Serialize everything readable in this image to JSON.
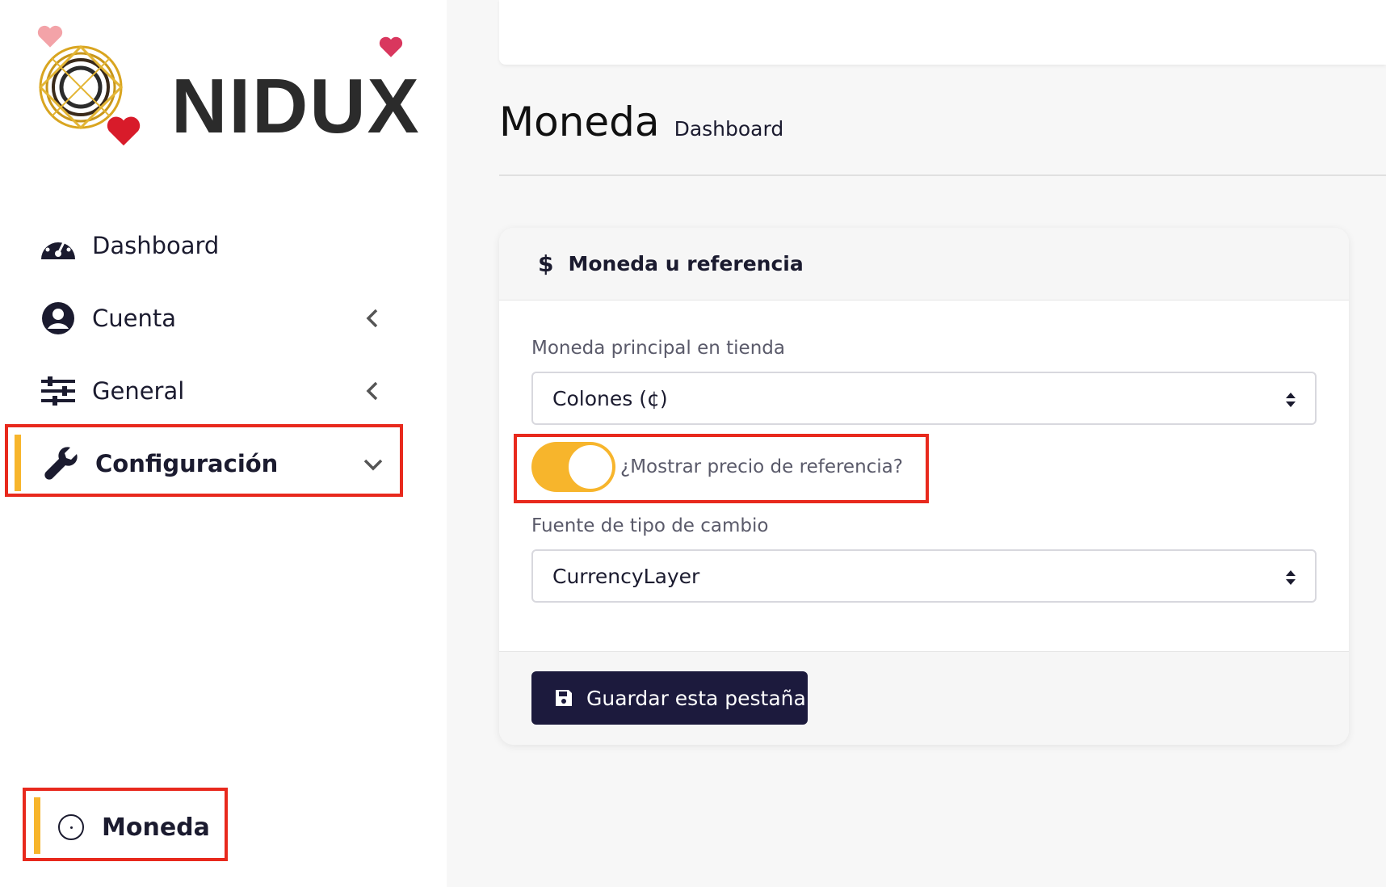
{
  "brand": {
    "name": "NIDUX",
    "accent": "#f7b52c",
    "highlight": "#e8291d",
    "button_color": "#1c1a3d"
  },
  "sidebar": {
    "items": [
      {
        "label": "Dashboard",
        "icon": "speedometer-icon"
      },
      {
        "label": "Cuenta",
        "icon": "user-circle-icon",
        "chevron": "chevron-left-icon"
      },
      {
        "label": "General",
        "icon": "sliders-icon",
        "chevron": "chevron-left-icon"
      },
      {
        "label": "Configuración",
        "icon": "wrench-icon",
        "chevron": "chevron-down-icon",
        "active": true
      }
    ],
    "sub_items": [
      {
        "label": "Moneda",
        "icon": "circle-dot-icon",
        "active": true
      }
    ]
  },
  "header": {
    "title": "Moneda",
    "breadcrumb": "Dashboard"
  },
  "card": {
    "title": "Moneda u referencia",
    "title_icon": "dollar-icon",
    "primary_currency_label": "Moneda principal en tienda",
    "primary_currency_value": "Colones (¢)",
    "toggle_label": "¿Mostrar precio de referencia?",
    "toggle_on": true,
    "exchange_source_label": "Fuente de tipo de cambio",
    "exchange_source_value": "CurrencyLayer",
    "save_label": "Guardar esta pestaña"
  }
}
